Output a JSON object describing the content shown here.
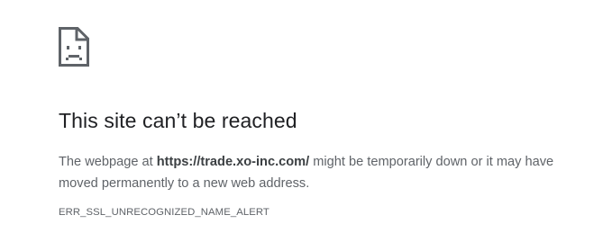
{
  "page": {
    "icon": "sad-document-icon",
    "title": "This site can’t be reached",
    "message": {
      "prefix": "The webpage at ",
      "url": "https://trade.xo-inc.com/",
      "suffix": " might be temporarily down or it may have moved permanently to a new web address."
    },
    "error_code": "ERR_SSL_UNRECOGNIZED_NAME_ALERT"
  },
  "colors": {
    "icon": "#5f6368",
    "title": "#202124",
    "body_text": "#5f6368",
    "background": "#ffffff"
  }
}
